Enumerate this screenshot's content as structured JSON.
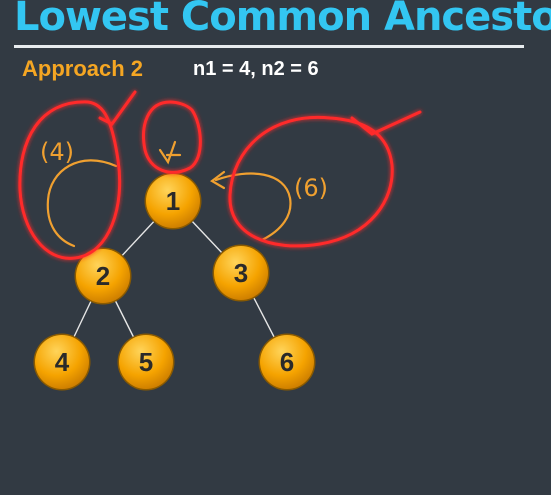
{
  "header": {
    "title": "Lowest Common Ancestor",
    "approach": "Approach 2",
    "query": "n1 = 4, n2 = 6"
  },
  "tree": {
    "nodes": [
      {
        "id": "n1",
        "label": "1"
      },
      {
        "id": "n2",
        "label": "2"
      },
      {
        "id": "n3",
        "label": "3"
      },
      {
        "id": "n4",
        "label": "4"
      },
      {
        "id": "n5",
        "label": "5"
      },
      {
        "id": "n6",
        "label": "6"
      }
    ],
    "edges": [
      {
        "from": "1",
        "to": "2"
      },
      {
        "from": "1",
        "to": "3"
      },
      {
        "from": "2",
        "to": "4"
      },
      {
        "from": "2",
        "to": "5"
      },
      {
        "from": "3",
        "to": "6"
      }
    ]
  },
  "annotations": {
    "left_note": "(4)",
    "right_note": "(6)",
    "root_mark": "୾"
  },
  "colors": {
    "background": "#323a43",
    "title": "#33c6f2",
    "approach": "#f5a623",
    "node_fill": "#f5a300",
    "ink_orange": "#f0a030",
    "ink_red": "#ff2b2b"
  }
}
